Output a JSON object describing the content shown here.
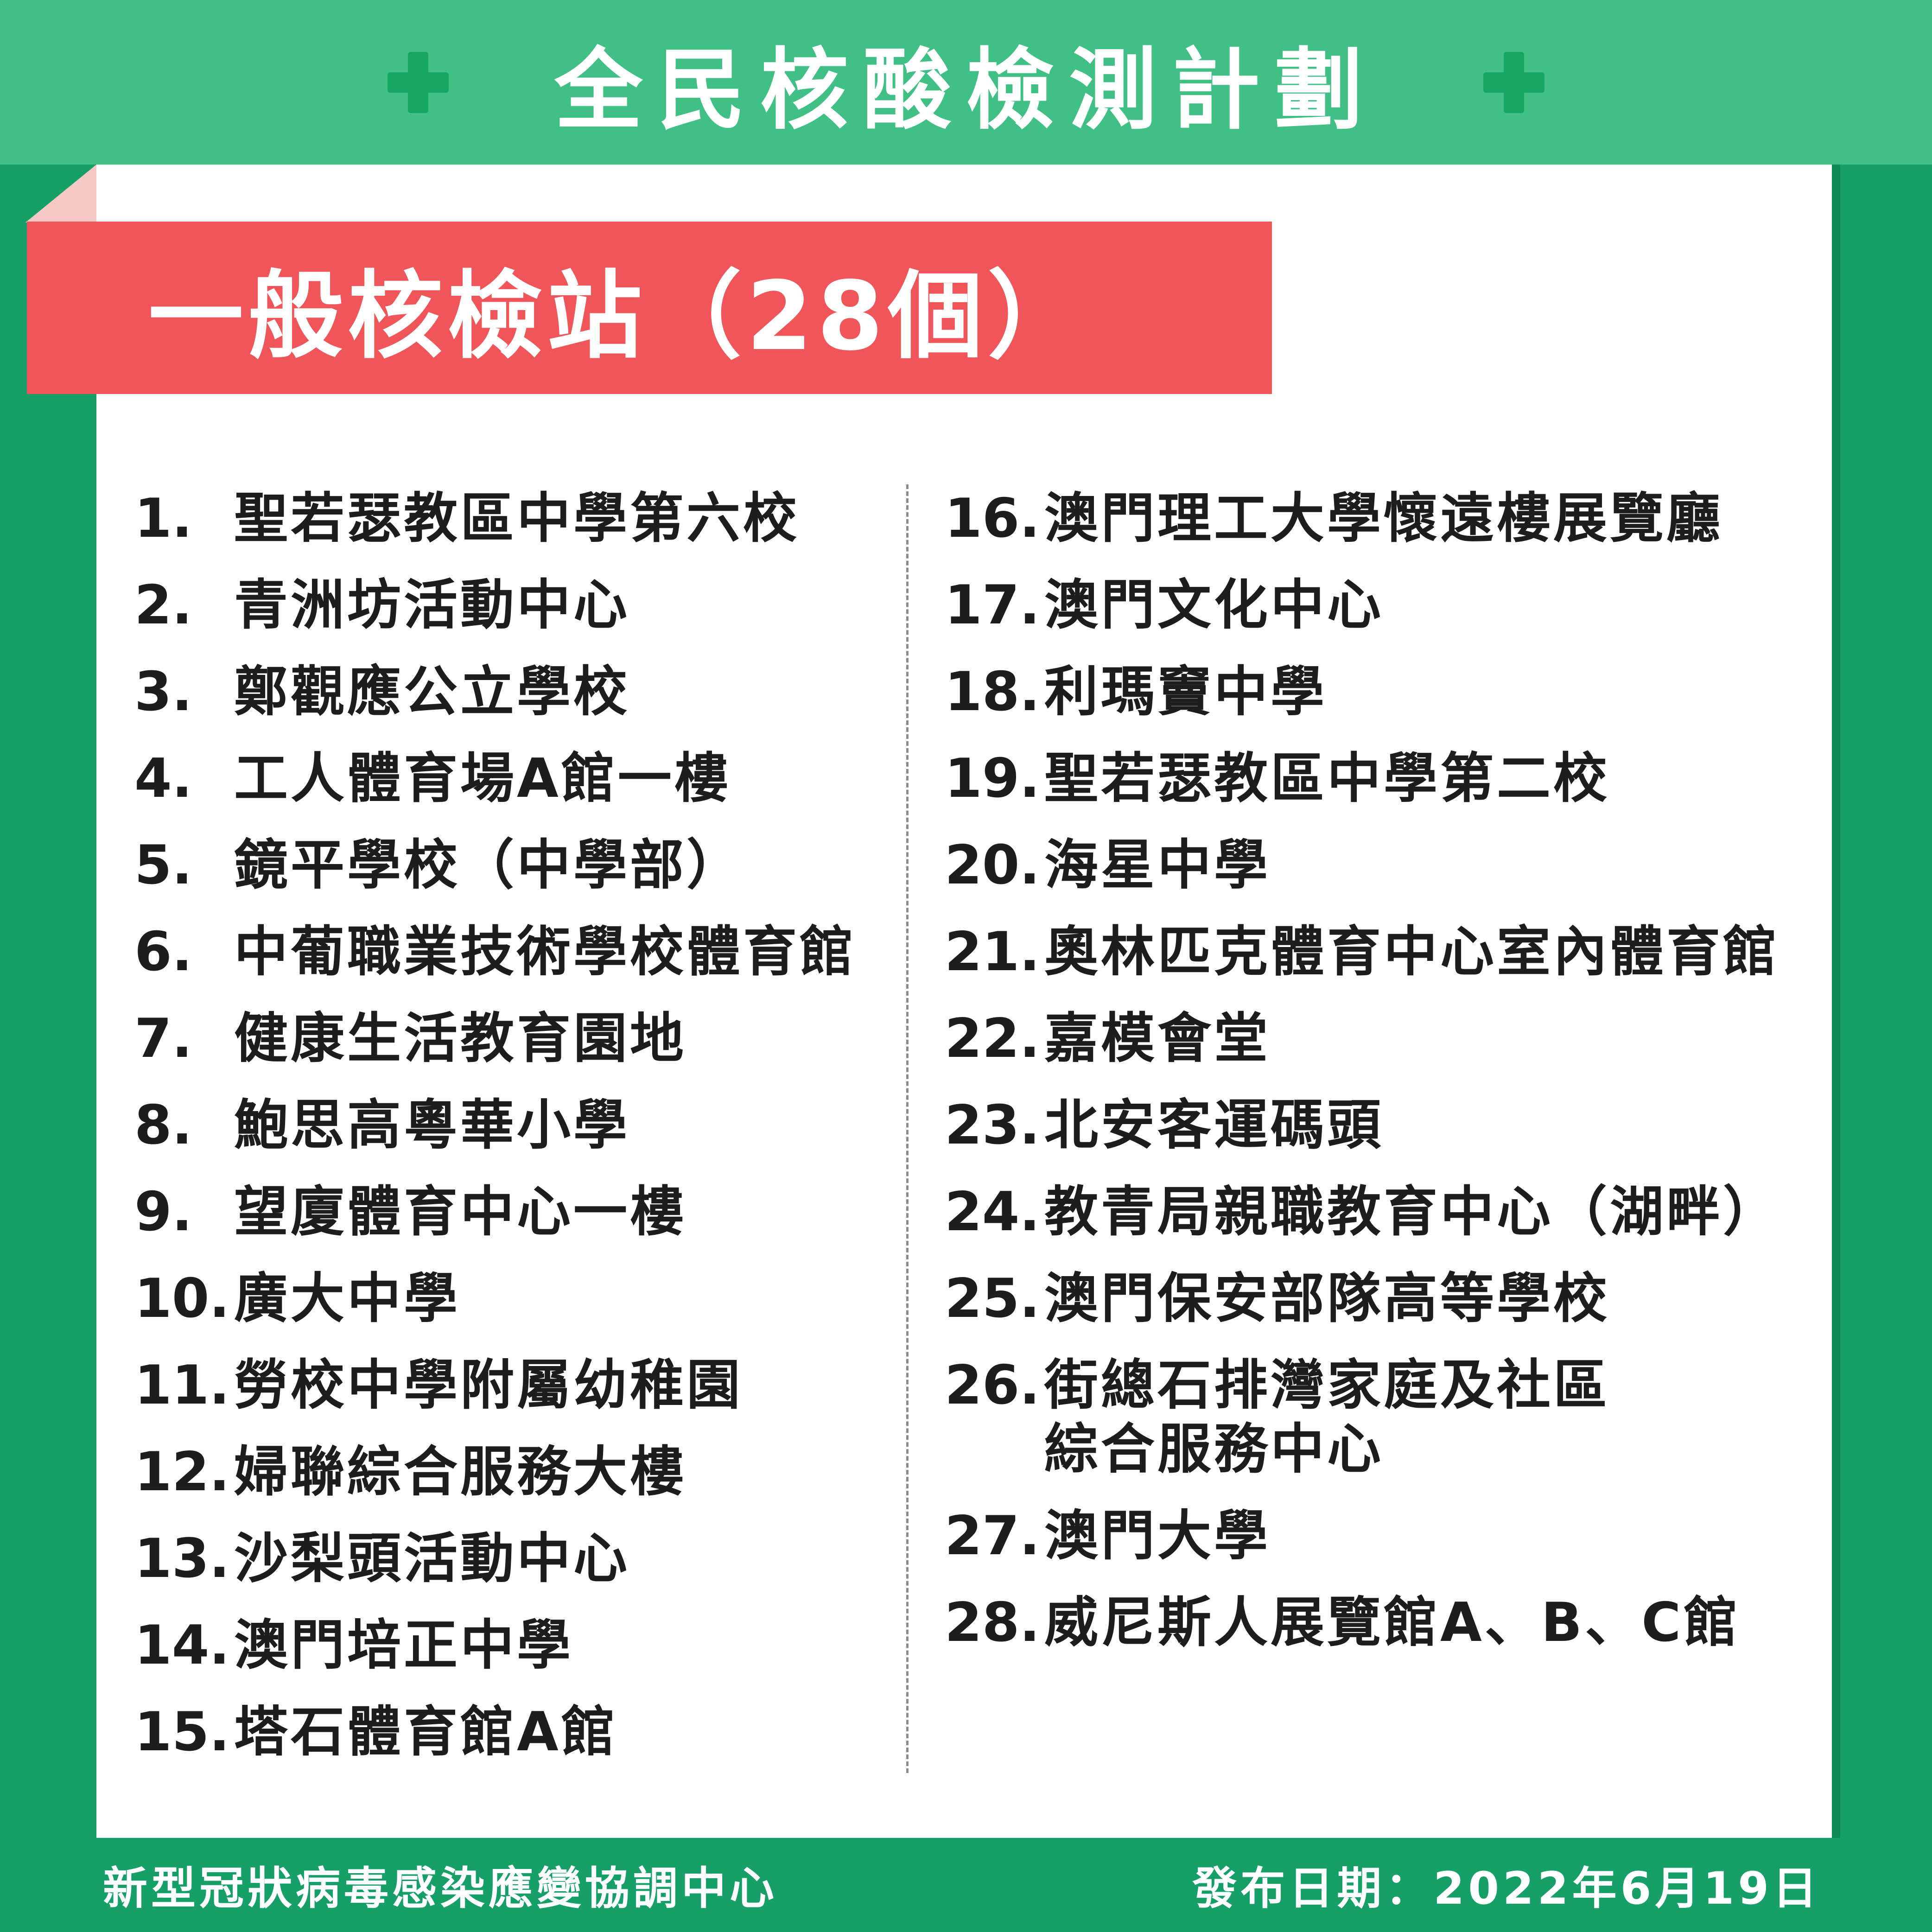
{
  "header": {
    "title": "全民核酸檢測計劃"
  },
  "section": {
    "title": "一般核檢站（28個）"
  },
  "stations_left": [
    {
      "num": "1.",
      "name": "聖若瑟教區中學第六校"
    },
    {
      "num": "2.",
      "name": "青洲坊活動中心"
    },
    {
      "num": "3.",
      "name": "鄭觀應公立學校"
    },
    {
      "num": "4.",
      "name": "工人體育場A館一樓"
    },
    {
      "num": "5.",
      "name": "鏡平學校（中學部）"
    },
    {
      "num": "6.",
      "name": "中葡職業技術學校體育館"
    },
    {
      "num": "7.",
      "name": "健康生活教育園地"
    },
    {
      "num": "8.",
      "name": "鮑思高粵華小學"
    },
    {
      "num": "9.",
      "name": "望廈體育中心一樓"
    },
    {
      "num": "10.",
      "name": "廣大中學"
    },
    {
      "num": "11.",
      "name": "勞校中學附屬幼稚園"
    },
    {
      "num": "12.",
      "name": "婦聯綜合服務大樓"
    },
    {
      "num": "13.",
      "name": "沙梨頭活動中心"
    },
    {
      "num": "14.",
      "name": "澳門培正中學"
    },
    {
      "num": "15.",
      "name": "塔石體育館A館"
    }
  ],
  "stations_right": [
    {
      "num": "16.",
      "name": "澳門理工大學懷遠樓展覽廳"
    },
    {
      "num": "17.",
      "name": "澳門文化中心"
    },
    {
      "num": "18.",
      "name": "利瑪竇中學"
    },
    {
      "num": "19.",
      "name": "聖若瑟教區中學第二校"
    },
    {
      "num": "20.",
      "name": "海星中學"
    },
    {
      "num": "21.",
      "name": "奧林匹克體育中心室內體育館"
    },
    {
      "num": "22.",
      "name": "嘉模會堂"
    },
    {
      "num": "23.",
      "name": "北安客運碼頭"
    },
    {
      "num": "24.",
      "name": "教青局親職教育中心（湖畔）"
    },
    {
      "num": "25.",
      "name": "澳門保安部隊高等學校"
    },
    {
      "num": "26.",
      "name": "街總石排灣家庭及社區\n綜合服務中心"
    },
    {
      "num": "27.",
      "name": "澳門大學"
    },
    {
      "num": "28.",
      "name": "威尼斯人展覽館A、B、C館"
    }
  ],
  "footer": {
    "org": "新型冠狀病毒感染應變協調中心",
    "date": "發布日期：2022年6月19日"
  },
  "colors": {
    "header_green": "#40c084",
    "border_green": "#16a067",
    "ribbon_red": "#ef5559",
    "plus_green": "#17a563"
  }
}
